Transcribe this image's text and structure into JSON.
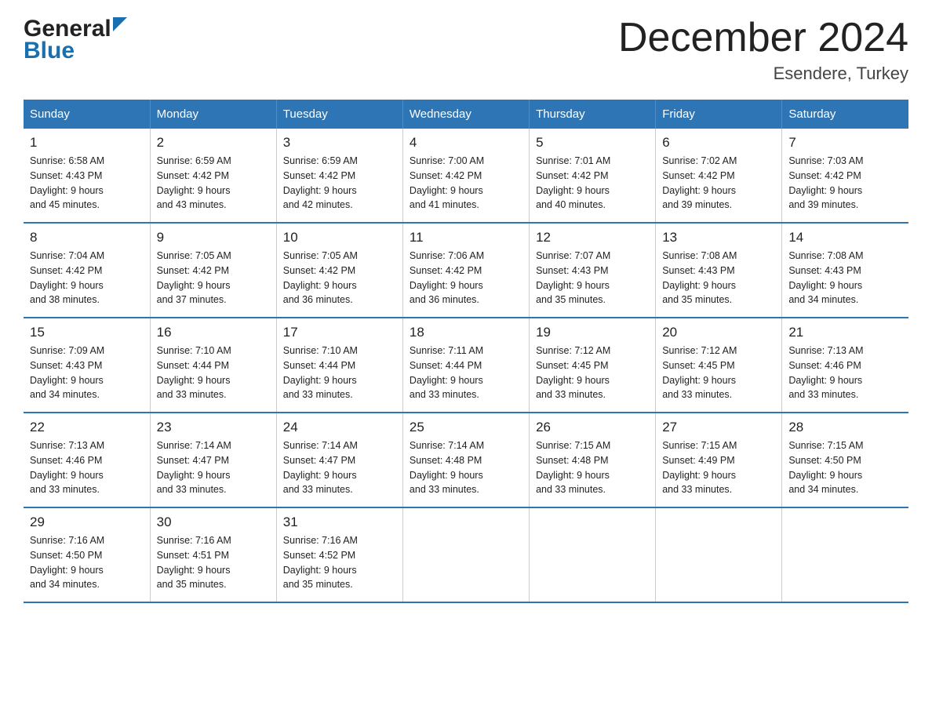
{
  "logo": {
    "general": "General",
    "blue": "Blue"
  },
  "header": {
    "title": "December 2024",
    "subtitle": "Esendere, Turkey"
  },
  "calendar": {
    "days": [
      "Sunday",
      "Monday",
      "Tuesday",
      "Wednesday",
      "Thursday",
      "Friday",
      "Saturday"
    ],
    "weeks": [
      [
        {
          "num": "1",
          "sunrise": "6:58 AM",
          "sunset": "4:43 PM",
          "daylight": "9 hours and 45 minutes."
        },
        {
          "num": "2",
          "sunrise": "6:59 AM",
          "sunset": "4:42 PM",
          "daylight": "9 hours and 43 minutes."
        },
        {
          "num": "3",
          "sunrise": "6:59 AM",
          "sunset": "4:42 PM",
          "daylight": "9 hours and 42 minutes."
        },
        {
          "num": "4",
          "sunrise": "7:00 AM",
          "sunset": "4:42 PM",
          "daylight": "9 hours and 41 minutes."
        },
        {
          "num": "5",
          "sunrise": "7:01 AM",
          "sunset": "4:42 PM",
          "daylight": "9 hours and 40 minutes."
        },
        {
          "num": "6",
          "sunrise": "7:02 AM",
          "sunset": "4:42 PM",
          "daylight": "9 hours and 39 minutes."
        },
        {
          "num": "7",
          "sunrise": "7:03 AM",
          "sunset": "4:42 PM",
          "daylight": "9 hours and 39 minutes."
        }
      ],
      [
        {
          "num": "8",
          "sunrise": "7:04 AM",
          "sunset": "4:42 PM",
          "daylight": "9 hours and 38 minutes."
        },
        {
          "num": "9",
          "sunrise": "7:05 AM",
          "sunset": "4:42 PM",
          "daylight": "9 hours and 37 minutes."
        },
        {
          "num": "10",
          "sunrise": "7:05 AM",
          "sunset": "4:42 PM",
          "daylight": "9 hours and 36 minutes."
        },
        {
          "num": "11",
          "sunrise": "7:06 AM",
          "sunset": "4:42 PM",
          "daylight": "9 hours and 36 minutes."
        },
        {
          "num": "12",
          "sunrise": "7:07 AM",
          "sunset": "4:43 PM",
          "daylight": "9 hours and 35 minutes."
        },
        {
          "num": "13",
          "sunrise": "7:08 AM",
          "sunset": "4:43 PM",
          "daylight": "9 hours and 35 minutes."
        },
        {
          "num": "14",
          "sunrise": "7:08 AM",
          "sunset": "4:43 PM",
          "daylight": "9 hours and 34 minutes."
        }
      ],
      [
        {
          "num": "15",
          "sunrise": "7:09 AM",
          "sunset": "4:43 PM",
          "daylight": "9 hours and 34 minutes."
        },
        {
          "num": "16",
          "sunrise": "7:10 AM",
          "sunset": "4:44 PM",
          "daylight": "9 hours and 33 minutes."
        },
        {
          "num": "17",
          "sunrise": "7:10 AM",
          "sunset": "4:44 PM",
          "daylight": "9 hours and 33 minutes."
        },
        {
          "num": "18",
          "sunrise": "7:11 AM",
          "sunset": "4:44 PM",
          "daylight": "9 hours and 33 minutes."
        },
        {
          "num": "19",
          "sunrise": "7:12 AM",
          "sunset": "4:45 PM",
          "daylight": "9 hours and 33 minutes."
        },
        {
          "num": "20",
          "sunrise": "7:12 AM",
          "sunset": "4:45 PM",
          "daylight": "9 hours and 33 minutes."
        },
        {
          "num": "21",
          "sunrise": "7:13 AM",
          "sunset": "4:46 PM",
          "daylight": "9 hours and 33 minutes."
        }
      ],
      [
        {
          "num": "22",
          "sunrise": "7:13 AM",
          "sunset": "4:46 PM",
          "daylight": "9 hours and 33 minutes."
        },
        {
          "num": "23",
          "sunrise": "7:14 AM",
          "sunset": "4:47 PM",
          "daylight": "9 hours and 33 minutes."
        },
        {
          "num": "24",
          "sunrise": "7:14 AM",
          "sunset": "4:47 PM",
          "daylight": "9 hours and 33 minutes."
        },
        {
          "num": "25",
          "sunrise": "7:14 AM",
          "sunset": "4:48 PM",
          "daylight": "9 hours and 33 minutes."
        },
        {
          "num": "26",
          "sunrise": "7:15 AM",
          "sunset": "4:48 PM",
          "daylight": "9 hours and 33 minutes."
        },
        {
          "num": "27",
          "sunrise": "7:15 AM",
          "sunset": "4:49 PM",
          "daylight": "9 hours and 33 minutes."
        },
        {
          "num": "28",
          "sunrise": "7:15 AM",
          "sunset": "4:50 PM",
          "daylight": "9 hours and 34 minutes."
        }
      ],
      [
        {
          "num": "29",
          "sunrise": "7:16 AM",
          "sunset": "4:50 PM",
          "daylight": "9 hours and 34 minutes."
        },
        {
          "num": "30",
          "sunrise": "7:16 AM",
          "sunset": "4:51 PM",
          "daylight": "9 hours and 35 minutes."
        },
        {
          "num": "31",
          "sunrise": "7:16 AM",
          "sunset": "4:52 PM",
          "daylight": "9 hours and 35 minutes."
        },
        null,
        null,
        null,
        null
      ]
    ],
    "labels": {
      "sunrise": "Sunrise:",
      "sunset": "Sunset:",
      "daylight": "Daylight:"
    }
  }
}
